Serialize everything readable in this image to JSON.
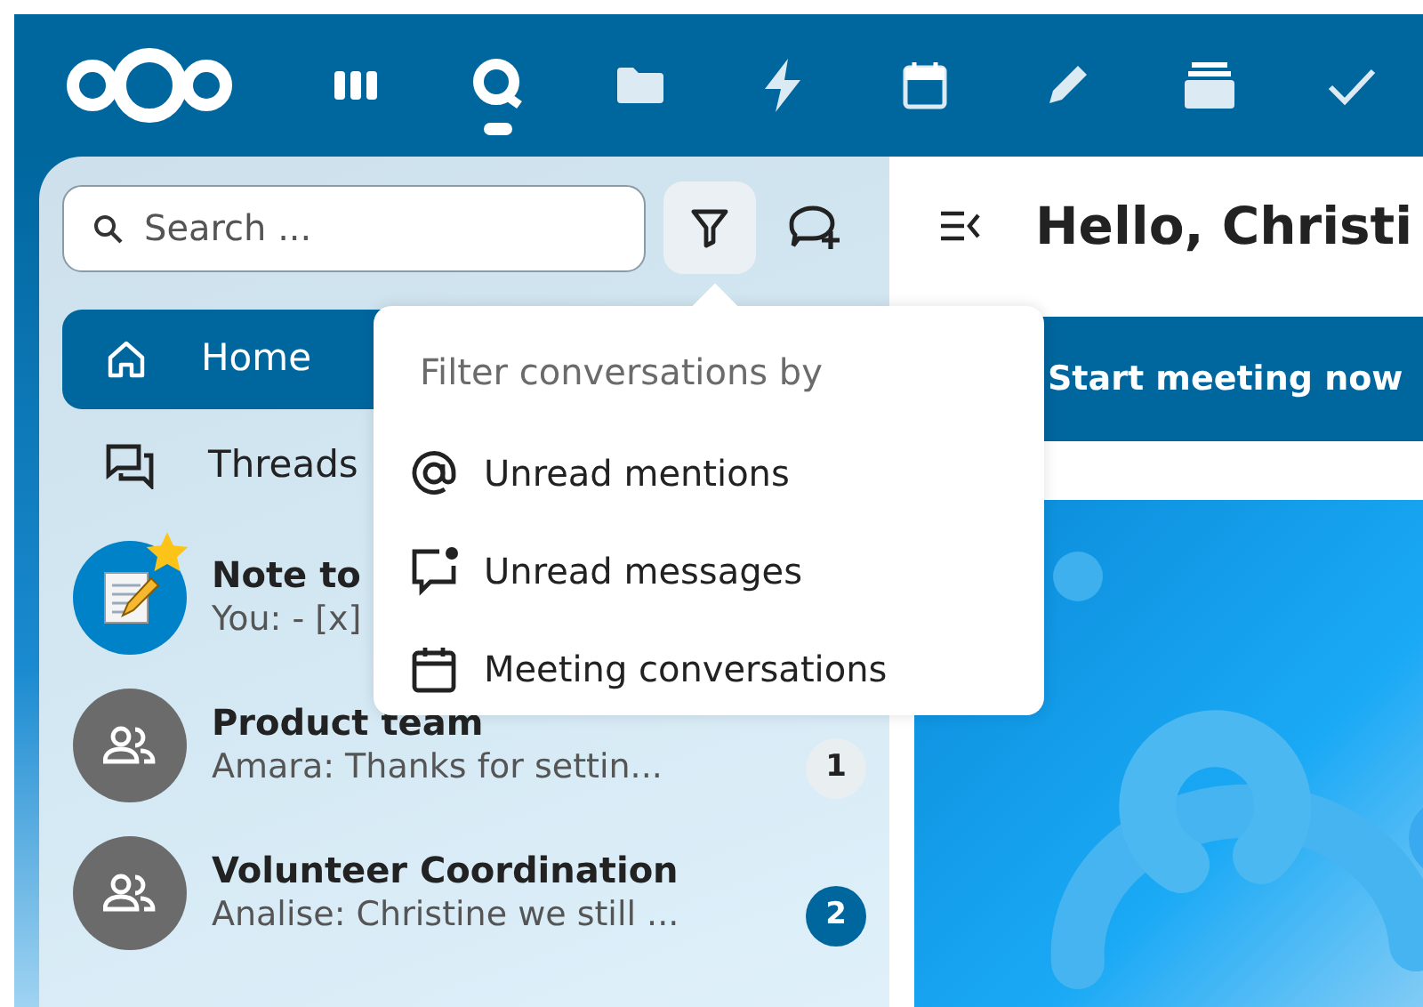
{
  "header": {
    "apps": [
      {
        "kind": "dashboard",
        "selected": false
      },
      {
        "kind": "talk",
        "selected": true
      },
      {
        "kind": "files",
        "selected": false
      },
      {
        "kind": "activity",
        "selected": false
      },
      {
        "kind": "calendar",
        "selected": false
      },
      {
        "kind": "notes",
        "selected": false
      },
      {
        "kind": "deck",
        "selected": false
      },
      {
        "kind": "tasks",
        "selected": false
      }
    ]
  },
  "sidebar": {
    "search": {
      "placeholder": "Search ..."
    },
    "nav": [
      {
        "kind": "home",
        "label": "Home",
        "selected": true
      },
      {
        "kind": "threads",
        "label": "Threads",
        "selected": false
      }
    ],
    "conversations": [
      {
        "kind": "note",
        "name": "Note to",
        "preview": "You: - [x]",
        "favorite": true
      },
      {
        "kind": "group",
        "name": "Product team",
        "preview": "Amara: Thanks for settin...",
        "favorite": false,
        "unread": {
          "count": "1",
          "mention": false
        }
      },
      {
        "kind": "group",
        "name": "Volunteer Coordination",
        "preview": "Analise: Christine we still ...",
        "favorite": false,
        "unread": {
          "count": "2",
          "mention": true
        }
      }
    ]
  },
  "filter_menu": {
    "heading": "Filter conversations by",
    "items": [
      {
        "kind": "mentions",
        "label": "Unread mentions"
      },
      {
        "kind": "messages",
        "label": "Unread messages"
      },
      {
        "kind": "meetings",
        "label": "Meeting conversations"
      }
    ]
  },
  "main": {
    "title": "Hello, Christi",
    "button": "Start meeting now"
  }
}
